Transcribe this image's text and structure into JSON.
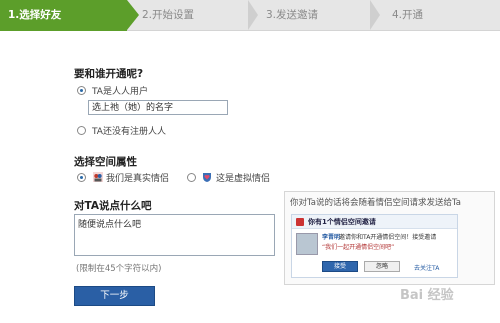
{
  "steps": [
    {
      "label": "1.选择好友",
      "active": true
    },
    {
      "label": "2.开始设置",
      "active": false
    },
    {
      "label": "3.发送邀请",
      "active": false
    },
    {
      "label": "4.开通",
      "active": false
    }
  ],
  "who": {
    "title": "要和谁开通呢?",
    "option_registered": "TA是人人用户",
    "input_value": "选上祂（她）的名字",
    "option_unregistered": "TA还没有注册人人"
  },
  "attribute": {
    "title": "选择空间属性",
    "option_real": "我们是真实情侣",
    "option_virtual": "这是虚拟情侣"
  },
  "message": {
    "title": "对TA说点什么吧",
    "value": "随便说点什么吧",
    "limit_hint": "(限制在45个字符以内)"
  },
  "next_label": "下一步",
  "preview": {
    "title": "你对Ta说的话将会随着情侣空间请求发送给Ta",
    "card_head": "你有1个情侣空间邀请",
    "name": "李晋明",
    "text": "邀请你和TA开通情侣空间！接受邀请",
    "quote": "“我们一起开通情侣空间吧”",
    "accept": "接受",
    "ignore": "忽略",
    "link": "去关注TA"
  },
  "watermark": "Bai 经验",
  "colors": {
    "accent_green": "#5c9e2a",
    "button_blue": "#2a5fa5"
  }
}
